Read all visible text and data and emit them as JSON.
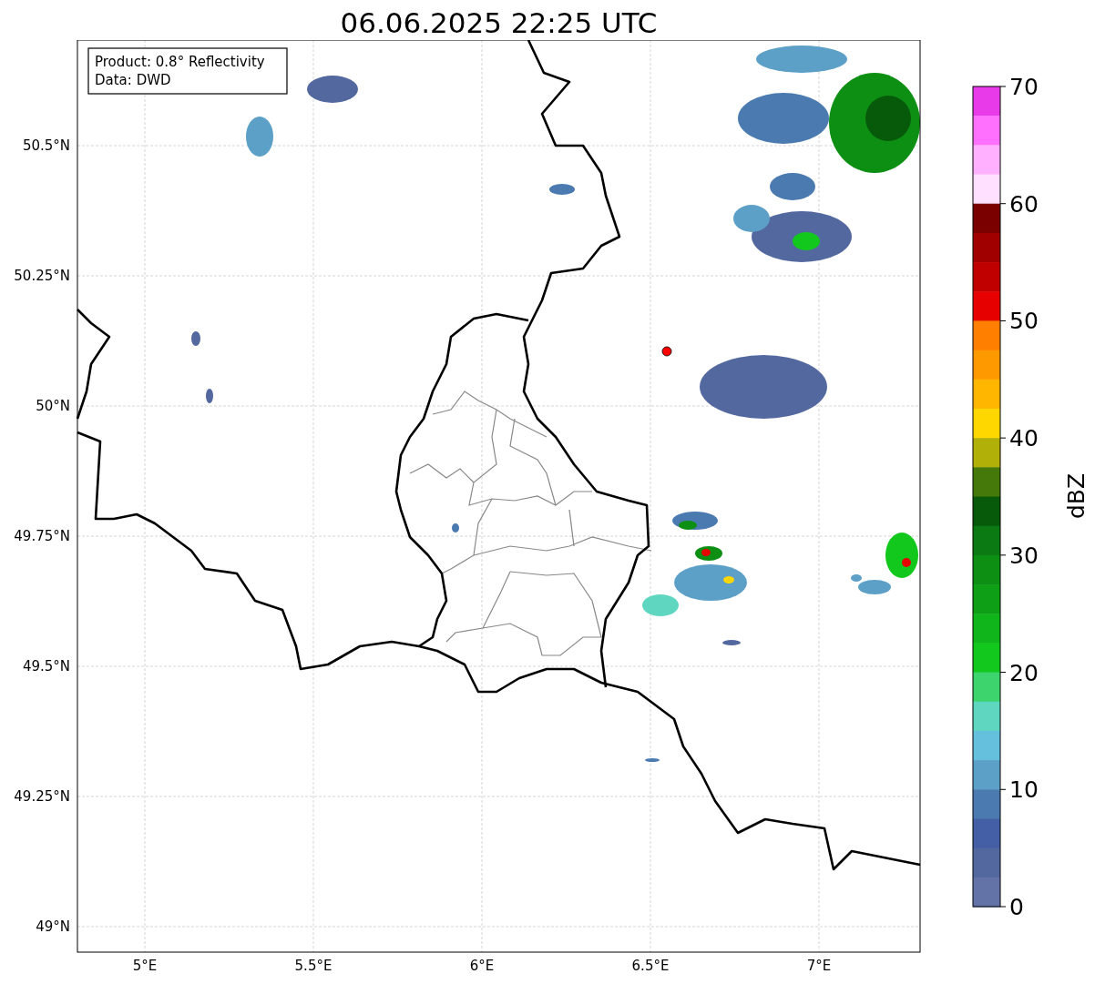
{
  "title": "06.06.2025 22:25 UTC",
  "legend": {
    "lines": [
      "Product: 0.8° Reflectivity",
      "Data: DWD"
    ]
  },
  "map": {
    "xticks": [
      "5°E",
      "5.5°E",
      "6°E",
      "6.5°E",
      "7°E"
    ],
    "yticks": [
      "50.5°N",
      "50.25°N",
      "50°N",
      "49.75°N",
      "49.5°N",
      "49.25°N",
      "49°N"
    ]
  },
  "colorbar": {
    "label": "dBZ",
    "ticks": [
      "70",
      "60",
      "50",
      "40",
      "30",
      "20",
      "10",
      "0"
    ],
    "bins": [
      {
        "color": "#e93ae9"
      },
      {
        "color": "#ff70ff"
      },
      {
        "color": "#ffb0ff"
      },
      {
        "color": "#ffe0ff"
      },
      {
        "color": "#7a0000"
      },
      {
        "color": "#a00000"
      },
      {
        "color": "#c00000"
      },
      {
        "color": "#e60000"
      },
      {
        "color": "#ff7f00"
      },
      {
        "color": "#ff9900"
      },
      {
        "color": "#ffb600"
      },
      {
        "color": "#ffd700"
      },
      {
        "color": "#b0b008"
      },
      {
        "color": "#457a0b"
      },
      {
        "color": "#085a0b"
      },
      {
        "color": "#0b7a12"
      },
      {
        "color": "#0d8f14"
      },
      {
        "color": "#0e9f17"
      },
      {
        "color": "#10b51b"
      },
      {
        "color": "#12c81d"
      },
      {
        "color": "#3dd46d"
      },
      {
        "color": "#5fd6c0"
      },
      {
        "color": "#64c0dc"
      },
      {
        "color": "#5ca0c8"
      },
      {
        "color": "#4a7ab0"
      },
      {
        "color": "#445fa5"
      },
      {
        "color": "#5468a0"
      },
      {
        "color": "#6373a7"
      }
    ]
  }
}
